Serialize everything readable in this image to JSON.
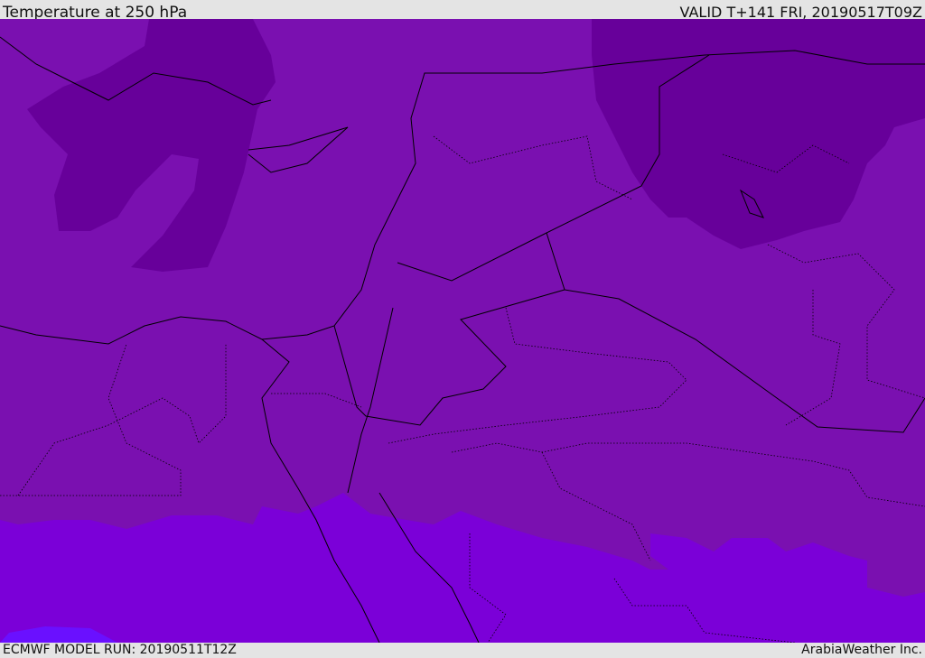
{
  "header": {
    "title": "Temperature at 250 hPa",
    "valid": "VALID T+141 FRI, 20190517T09Z"
  },
  "footer": {
    "model_run": "ECMWF MODEL RUN: 20190511T12Z",
    "credit": "ArabiaWeather Inc."
  },
  "map": {
    "colors": {
      "base": "#7a10b0",
      "cold": "#67009a",
      "warm": "#7b00d8",
      "warmest": "#6a10ff",
      "boundary": "#000000"
    }
  }
}
